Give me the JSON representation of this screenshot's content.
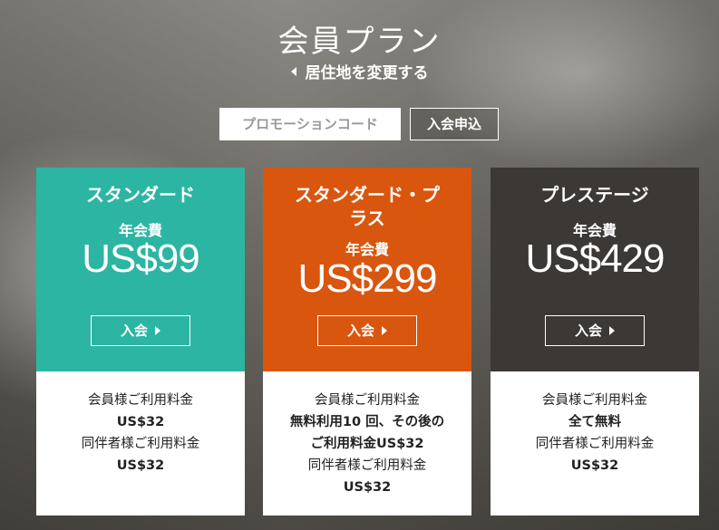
{
  "header": {
    "title": "会員プラン",
    "change_country": "居住地を変更する",
    "promo_placeholder": "プロモーションコード",
    "join_button": "入会申込"
  },
  "plans": [
    {
      "name": "スタンダード",
      "fee_label": "年会費",
      "price": "US$99",
      "button": "入会",
      "color": "#2db5a3",
      "details": [
        "会員様ご利用料金",
        "US$32",
        "同伴者様ご利用料金",
        "US$32"
      ]
    },
    {
      "name_line1": "スタンダード・プ",
      "name_line2": "ラス",
      "fee_label": "年会費",
      "price": "US$299",
      "button": "入会",
      "color": "#d9560f",
      "details": [
        "会員様ご利用料金",
        "無料利用10 回、その後の",
        "ご利用料金US$32",
        "同伴者様ご利用料金",
        "US$32"
      ]
    },
    {
      "name": "プレステージ",
      "fee_label": "年会費",
      "price": "US$429",
      "button": "入会",
      "color": "#3b3835",
      "details": [
        "会員様ご利用料金",
        "全て無料",
        "同伴者様ご利用料金",
        "US$32"
      ]
    }
  ],
  "icons": {
    "change_country": "triangle-left-icon",
    "card_button": "triangle-right-icon"
  }
}
